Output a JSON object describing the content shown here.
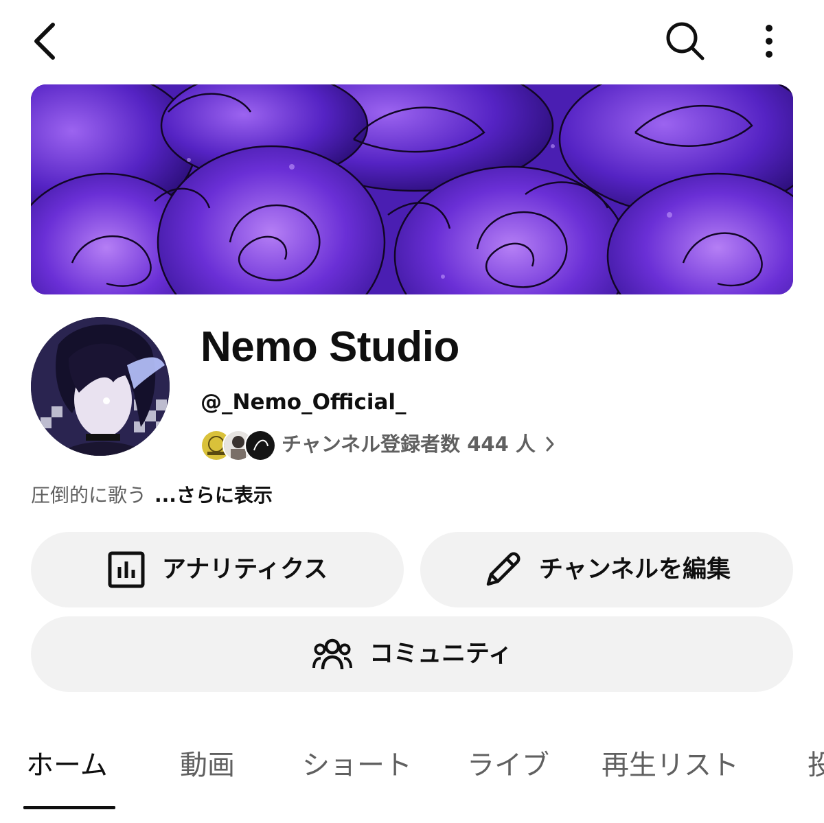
{
  "top_bar": {
    "back_icon": "chevron-left-icon",
    "search_icon": "search-icon",
    "more_icon": "more-vertical-icon"
  },
  "banner": {
    "description": "",
    "colors": [
      "#4b1fb0",
      "#7a3ee0",
      "#a876f0",
      "#2a0f6e"
    ]
  },
  "channel": {
    "name": "Nemo Studio",
    "handle": "@_Nemo_Official_",
    "subscribers_text": "チャンネル登録者数 444 人",
    "description": "圧倒的に歌う",
    "more_link": "...さらに表示"
  },
  "buttons": {
    "analytics": {
      "label": "アナリティクス",
      "icon": "analytics-icon"
    },
    "edit": {
      "label": "チャンネルを編集",
      "icon": "pencil-icon"
    },
    "community": {
      "label": "コミュニティ",
      "icon": "community-icon"
    }
  },
  "tabs": [
    {
      "label": "ホーム",
      "active": true
    },
    {
      "label": "動画",
      "active": false
    },
    {
      "label": "ショート",
      "active": false
    },
    {
      "label": "ライブ",
      "active": false
    },
    {
      "label": "再生リスト",
      "active": false
    },
    {
      "label": "投",
      "active": false
    }
  ],
  "colors": {
    "text_primary": "#0f0f0f",
    "text_secondary": "#606060",
    "button_bg": "#f2f2f2"
  }
}
